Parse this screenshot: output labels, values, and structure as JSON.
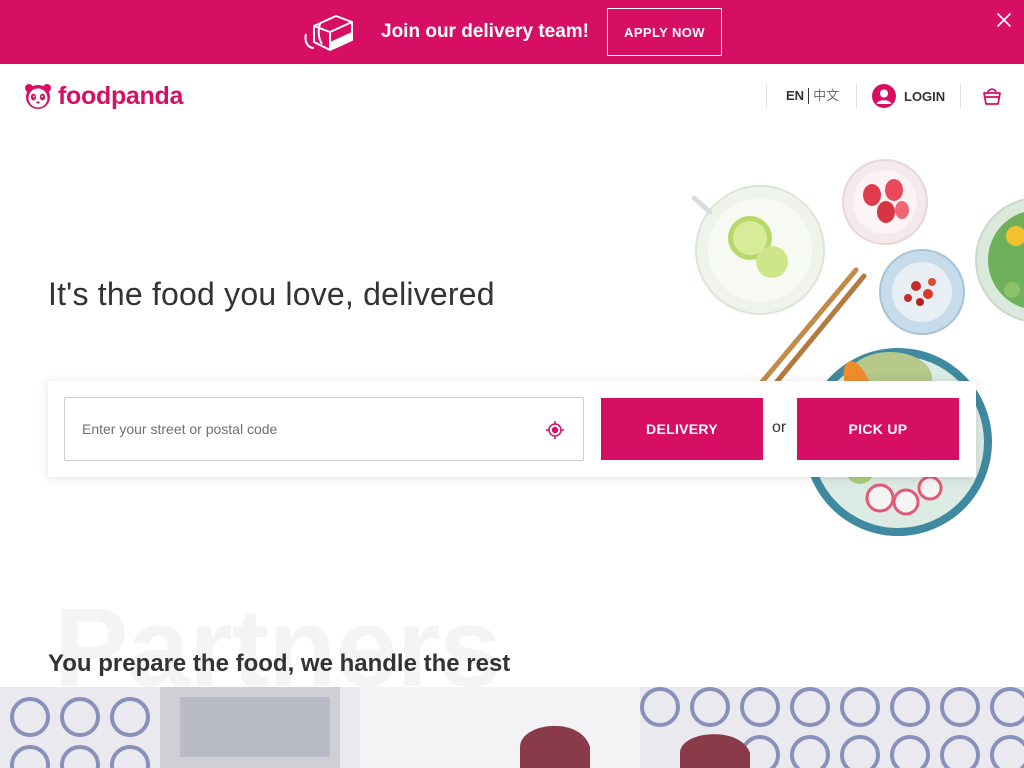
{
  "promo": {
    "text": "Join our delivery team!",
    "button_label": "APPLY NOW",
    "icon": "delivery-bag-icon",
    "close_icon": "close-icon"
  },
  "header": {
    "brand": "foodpanda",
    "logo_icon": "panda-logo-icon",
    "languages": {
      "active": "EN",
      "other": "中文"
    },
    "login_label": "LOGIN",
    "login_icon": "user-avatar-icon",
    "cart_icon": "shopping-basket-icon"
  },
  "hero": {
    "title": "It's the food you love, delivered",
    "search": {
      "placeholder": "Enter your street or postal code",
      "value": "",
      "locate_icon": "crosshair-locate-icon"
    },
    "delivery_label": "DELIVERY",
    "or_label": "or",
    "pickup_label": "PICK UP"
  },
  "partners": {
    "background_word": "Partners",
    "subtitle": "You prepare the food, we handle the rest"
  },
  "colors": {
    "brand": "#d70f64",
    "text": "#333333",
    "muted": "#707070",
    "border": "#cfcfcf"
  }
}
